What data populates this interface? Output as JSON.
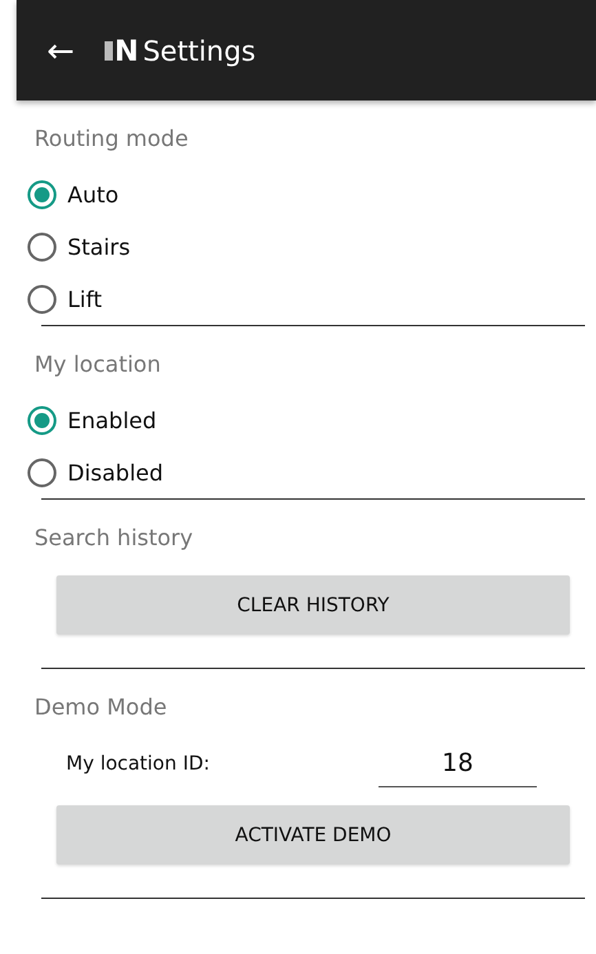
{
  "toolbar": {
    "back": "←",
    "logo_text": "N",
    "title": "Settings"
  },
  "sections": [
    {
      "kind": "radio",
      "title": "Routing mode",
      "options": [
        {
          "label": "Auto",
          "selected": true
        },
        {
          "label": "Stairs",
          "selected": false
        },
        {
          "label": "Lift",
          "selected": false
        }
      ]
    },
    {
      "kind": "radio",
      "title": "My location",
      "options": [
        {
          "label": "Enabled",
          "selected": true
        },
        {
          "label": "Disabled",
          "selected": false
        }
      ]
    },
    {
      "kind": "button",
      "title": "Search history",
      "button": "CLEAR HISTORY"
    },
    {
      "kind": "demo",
      "title": "Demo Mode",
      "field_label": "My location ID:",
      "field_value": "18",
      "button": "ACTIVATE DEMO"
    }
  ]
}
